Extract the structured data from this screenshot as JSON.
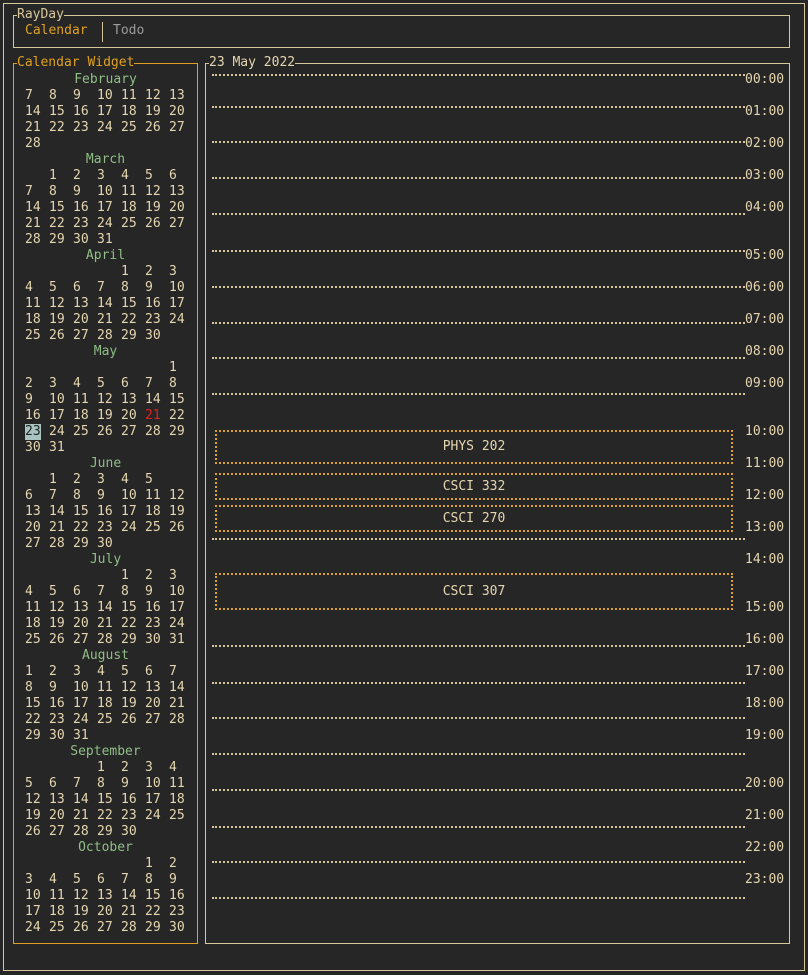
{
  "app": {
    "title": "RayDay"
  },
  "tabs": [
    {
      "label": "Calendar",
      "active": true
    },
    {
      "label": "Todo",
      "active": false
    }
  ],
  "calendar_widget": {
    "title": "Calendar Widget",
    "months": [
      {
        "name": "February",
        "rows": [
          [
            "7",
            "8",
            "9",
            "10",
            "11",
            "12",
            "13"
          ],
          [
            "14",
            "15",
            "16",
            "17",
            "18",
            "19",
            "20"
          ],
          [
            "21",
            "22",
            "23",
            "24",
            "25",
            "26",
            "27"
          ],
          [
            "28",
            "",
            "",
            "",
            "",
            "",
            ""
          ]
        ]
      },
      {
        "name": "March",
        "rows": [
          [
            "",
            "1",
            "2",
            "3",
            "4",
            "5",
            "6"
          ],
          [
            "7",
            "8",
            "9",
            "10",
            "11",
            "12",
            "13"
          ],
          [
            "14",
            "15",
            "16",
            "17",
            "18",
            "19",
            "20"
          ],
          [
            "21",
            "22",
            "23",
            "24",
            "25",
            "26",
            "27"
          ],
          [
            "28",
            "29",
            "30",
            "31",
            "",
            "",
            ""
          ]
        ]
      },
      {
        "name": "April",
        "rows": [
          [
            "",
            "",
            "",
            "",
            "1",
            "2",
            "3"
          ],
          [
            "4",
            "5",
            "6",
            "7",
            "8",
            "9",
            "10"
          ],
          [
            "11",
            "12",
            "13",
            "14",
            "15",
            "16",
            "17"
          ],
          [
            "18",
            "19",
            "20",
            "21",
            "22",
            "23",
            "24"
          ],
          [
            "25",
            "26",
            "27",
            "28",
            "29",
            "30",
            ""
          ]
        ]
      },
      {
        "name": "May",
        "rows": [
          [
            "",
            "",
            "",
            "",
            "",
            "",
            "1"
          ],
          [
            "2",
            "3",
            "4",
            "5",
            "6",
            "7",
            "8"
          ],
          [
            "9",
            "10",
            "11",
            "12",
            "13",
            "14",
            "15"
          ],
          [
            "16",
            "17",
            "18",
            "19",
            "20",
            "21",
            "22"
          ],
          [
            "23",
            "24",
            "25",
            "26",
            "27",
            "28",
            "29"
          ],
          [
            "30",
            "31",
            "",
            "",
            "",
            "",
            ""
          ]
        ],
        "highlighted": "21",
        "selected": "23"
      },
      {
        "name": "June",
        "rows": [
          [
            "",
            "1",
            "2",
            "3",
            "4",
            "5",
            ""
          ],
          [
            "6",
            "7",
            "8",
            "9",
            "10",
            "11",
            "12"
          ],
          [
            "13",
            "14",
            "15",
            "16",
            "17",
            "18",
            "19"
          ],
          [
            "20",
            "21",
            "22",
            "23",
            "24",
            "25",
            "26"
          ],
          [
            "27",
            "28",
            "29",
            "30",
            "",
            "",
            ""
          ]
        ]
      },
      {
        "name": "July",
        "rows": [
          [
            "",
            "",
            "",
            "",
            "1",
            "2",
            "3"
          ],
          [
            "4",
            "5",
            "6",
            "7",
            "8",
            "9",
            "10"
          ],
          [
            "11",
            "12",
            "13",
            "14",
            "15",
            "16",
            "17"
          ],
          [
            "18",
            "19",
            "20",
            "21",
            "22",
            "23",
            "24"
          ],
          [
            "25",
            "26",
            "27",
            "28",
            "29",
            "30",
            "31"
          ]
        ]
      },
      {
        "name": "August",
        "rows": [
          [
            "1",
            "2",
            "3",
            "4",
            "5",
            "6",
            "7"
          ],
          [
            "8",
            "9",
            "10",
            "11",
            "12",
            "13",
            "14"
          ],
          [
            "15",
            "16",
            "17",
            "18",
            "19",
            "20",
            "21"
          ],
          [
            "22",
            "23",
            "24",
            "25",
            "26",
            "27",
            "28"
          ],
          [
            "29",
            "30",
            "31",
            "",
            "",
            "",
            ""
          ]
        ]
      },
      {
        "name": "September",
        "rows": [
          [
            "",
            "",
            "",
            "1",
            "2",
            "3",
            "4"
          ],
          [
            "5",
            "6",
            "7",
            "8",
            "9",
            "10",
            "11"
          ],
          [
            "12",
            "13",
            "14",
            "15",
            "16",
            "17",
            "18"
          ],
          [
            "19",
            "20",
            "21",
            "22",
            "23",
            "24",
            "25"
          ],
          [
            "26",
            "27",
            "28",
            "29",
            "30",
            "",
            ""
          ]
        ]
      },
      {
        "name": "October",
        "rows": [
          [
            "",
            "",
            "",
            "",
            "",
            "1",
            "2"
          ],
          [
            "3",
            "4",
            "5",
            "6",
            "7",
            "8",
            "9"
          ],
          [
            "10",
            "11",
            "12",
            "13",
            "14",
            "15",
            "16"
          ],
          [
            "17",
            "18",
            "19",
            "20",
            "21",
            "22",
            "23"
          ],
          [
            "24",
            "25",
            "26",
            "27",
            "28",
            "29",
            "30"
          ]
        ]
      }
    ]
  },
  "day_view": {
    "title": "23 May 2022",
    "hours": [
      "00:00",
      "01:00",
      "02:00",
      "03:00",
      "04:00",
      "05:00",
      "06:00",
      "07:00",
      "08:00",
      "09:00",
      "10:00",
      "11:00",
      "12:00",
      "13:00",
      "14:00",
      "15:00",
      "16:00",
      "17:00",
      "18:00",
      "19:00",
      "20:00",
      "21:00",
      "22:00",
      "23:00"
    ],
    "events": [
      {
        "label": "PHYS 202"
      },
      {
        "label": "CSCI 332"
      },
      {
        "label": "CSCI 270"
      },
      {
        "label": "CSCI 307"
      }
    ]
  },
  "colors": {
    "background": "#262626",
    "text": "#e6d6b0",
    "accent": "#e0a020",
    "month_name": "#8fbf86",
    "highlighted_day": "#e02020",
    "selected_day_bg": "#a8c4c0"
  }
}
